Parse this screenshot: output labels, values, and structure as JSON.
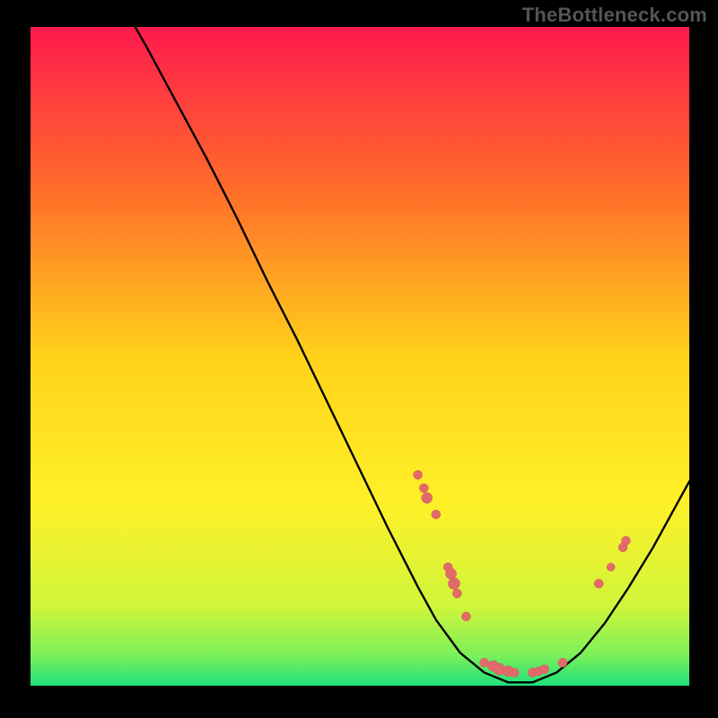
{
  "attribution": "TheBottleneck.com",
  "colors": {
    "curve_stroke": "#000000",
    "marker_fill": "#e36a6a",
    "marker_stroke": "#cc5a5a",
    "background": "#000000"
  },
  "gradient_stops": [
    {
      "offset": 0.0,
      "color": "#ff1a4d"
    },
    {
      "offset": 0.25,
      "color": "#ff6e2a"
    },
    {
      "offset": 0.5,
      "color": "#ffd21a"
    },
    {
      "offset": 0.72,
      "color": "#fff028"
    },
    {
      "offset": 0.88,
      "color": "#d0f53a"
    },
    {
      "offset": 0.955,
      "color": "#7af05a"
    },
    {
      "offset": 1.0,
      "color": "#1de07a"
    }
  ],
  "chart_data": {
    "type": "line",
    "title": "",
    "xlabel": "",
    "ylabel": "",
    "x": [
      0,
      5,
      10,
      15,
      20,
      25,
      30,
      35,
      40,
      45,
      50,
      55,
      58,
      62,
      66,
      70,
      74,
      78,
      82,
      86,
      90,
      94,
      100
    ],
    "values": [
      112,
      105,
      97,
      88.5,
      80,
      71,
      61.5,
      52.5,
      43,
      33.5,
      24,
      15,
      10,
      5,
      2,
      0.5,
      0.5,
      2,
      5,
      9.5,
      15,
      21,
      31
    ],
    "optimal_x": 72,
    "xlim": [
      0,
      100
    ],
    "ylim": [
      0,
      100
    ],
    "markers": [
      {
        "x": 55,
        "y": 32,
        "r": 5
      },
      {
        "x": 56,
        "y": 30,
        "r": 5
      },
      {
        "x": 56.5,
        "y": 28.5,
        "r": 6
      },
      {
        "x": 58,
        "y": 26,
        "r": 5
      },
      {
        "x": 60,
        "y": 18,
        "r": 5
      },
      {
        "x": 60.5,
        "y": 17,
        "r": 6
      },
      {
        "x": 61,
        "y": 15.5,
        "r": 6.5
      },
      {
        "x": 61.5,
        "y": 14,
        "r": 5
      },
      {
        "x": 63,
        "y": 10.5,
        "r": 5
      },
      {
        "x": 66,
        "y": 3.5,
        "r": 5
      },
      {
        "x": 67.5,
        "y": 3,
        "r": 6
      },
      {
        "x": 68.5,
        "y": 2.5,
        "r": 6.5
      },
      {
        "x": 70,
        "y": 2.2,
        "r": 6
      },
      {
        "x": 71,
        "y": 2,
        "r": 5
      },
      {
        "x": 74,
        "y": 2,
        "r": 5
      },
      {
        "x": 75,
        "y": 2.2,
        "r": 5
      },
      {
        "x": 76,
        "y": 2.5,
        "r": 5
      },
      {
        "x": 79,
        "y": 3.5,
        "r": 5
      },
      {
        "x": 85,
        "y": 15.5,
        "r": 5
      },
      {
        "x": 87,
        "y": 18,
        "r": 4.5
      },
      {
        "x": 89,
        "y": 21,
        "r": 5
      },
      {
        "x": 89.5,
        "y": 22,
        "r": 5
      }
    ]
  }
}
